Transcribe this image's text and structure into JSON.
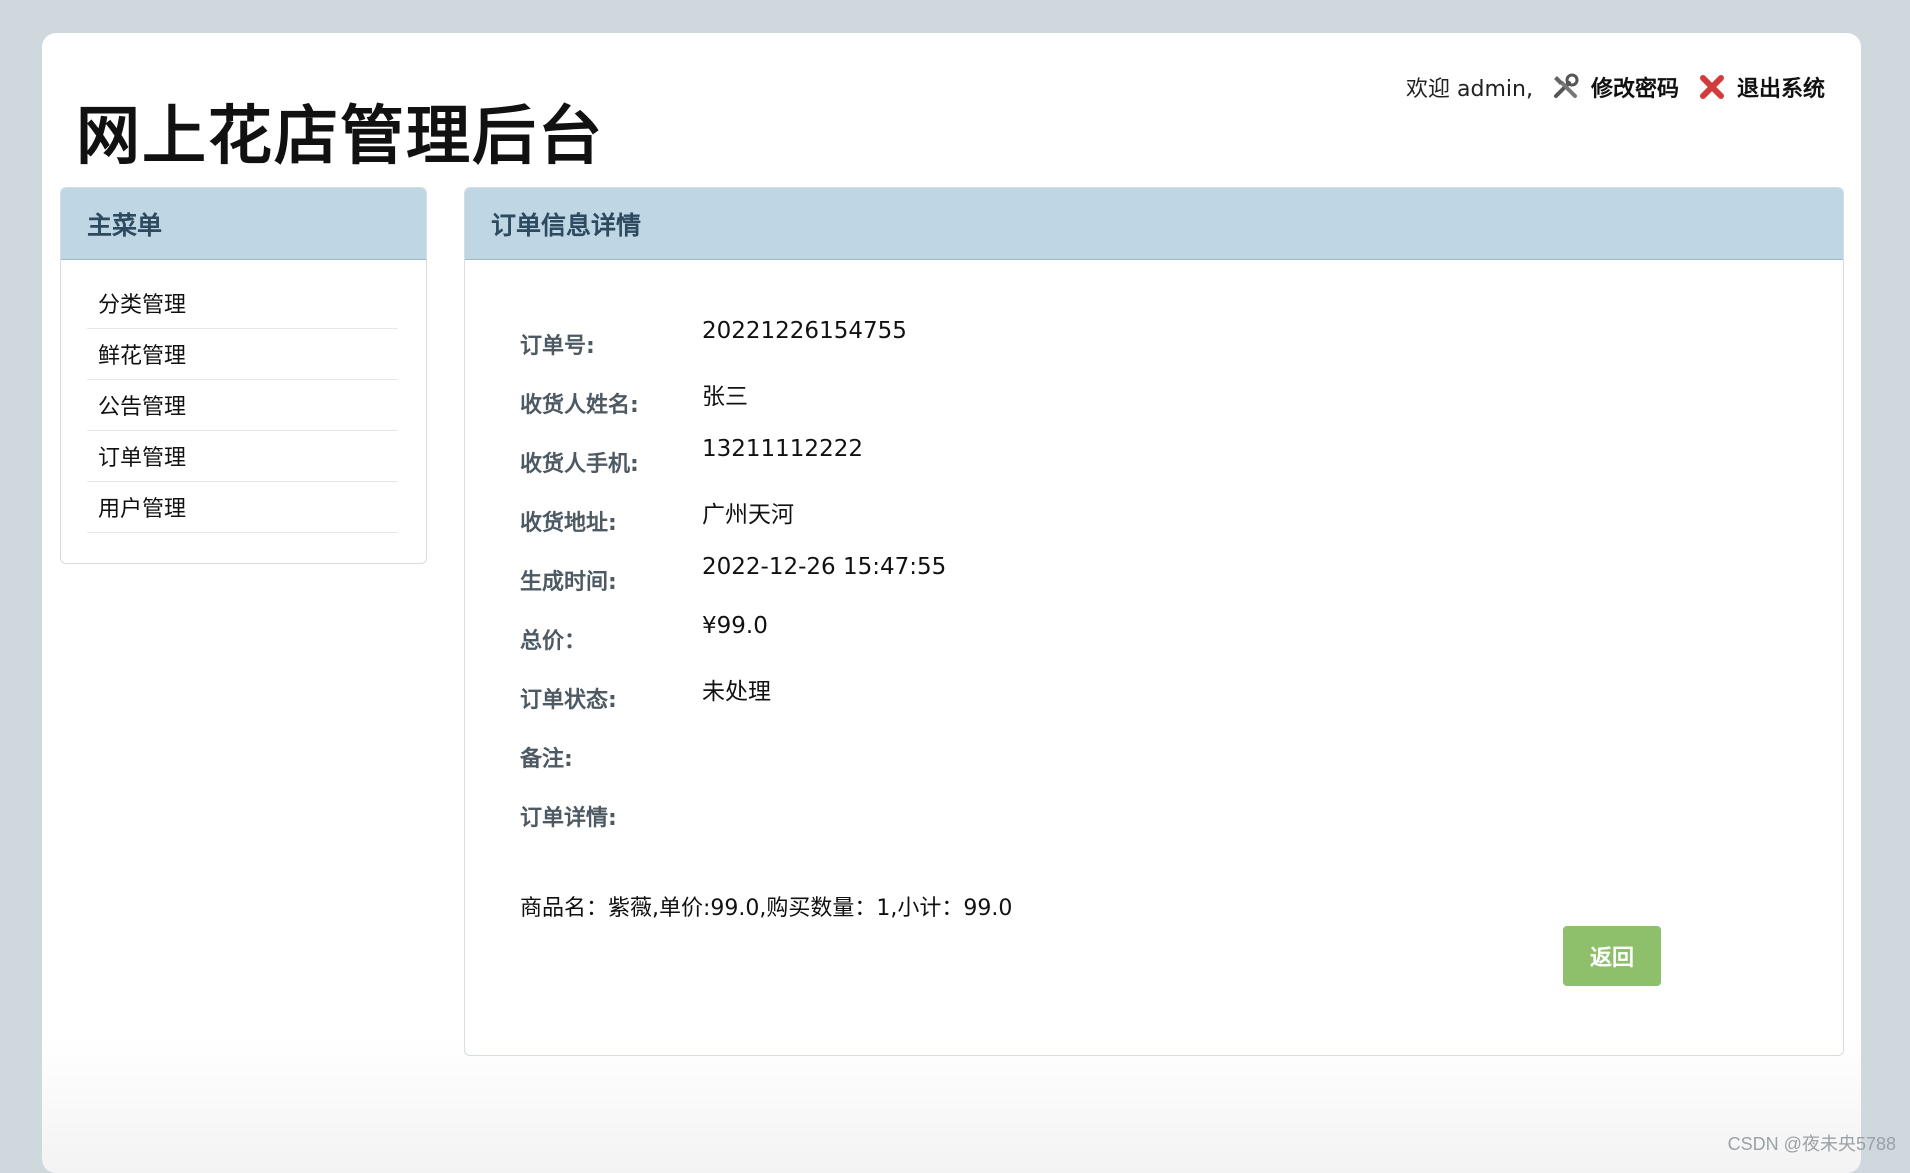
{
  "header": {
    "site_title": "网上花店管理后台",
    "welcome": "欢迎 admin,",
    "change_password": "修改密码",
    "logout": "退出系统"
  },
  "sidebar": {
    "title": "主菜单",
    "items": [
      {
        "label": "分类管理"
      },
      {
        "label": "鲜花管理"
      },
      {
        "label": "公告管理"
      },
      {
        "label": "订单管理"
      },
      {
        "label": "用户管理"
      }
    ]
  },
  "main": {
    "title": "订单信息详情",
    "fields": [
      {
        "label": "订单号:",
        "value": "20221226154755"
      },
      {
        "label": "收货人姓名:",
        "value": "张三"
      },
      {
        "label": "收货人手机:",
        "value": "13211112222"
      },
      {
        "label": "收货地址:",
        "value": "广州天河"
      },
      {
        "label": "生成时间:",
        "value": "2022-12-26 15:47:55"
      },
      {
        "label": "总价：",
        "value": "¥99.0"
      },
      {
        "label": "订单状态:",
        "value": "未处理"
      },
      {
        "label": "备注:",
        "value": ""
      },
      {
        "label": "订单详情:",
        "value": ""
      }
    ],
    "items_line": "商品名：紫薇,单价:99.0,购买数量：1,小计：99.0",
    "back_button": "返回"
  },
  "colors": {
    "panel_header": "#bfd6e5",
    "button_green": "#8ec06c",
    "background": "#cfd8dc"
  },
  "watermark": "CSDN @夜未央5788"
}
